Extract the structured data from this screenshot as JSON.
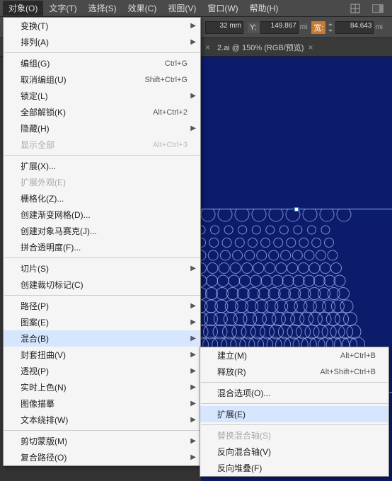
{
  "menubar": {
    "items": [
      {
        "label": "对象(O)",
        "active": true
      },
      {
        "label": "文字(T)"
      },
      {
        "label": "选择(S)"
      },
      {
        "label": "效果(C)"
      },
      {
        "label": "视图(V)"
      },
      {
        "label": "窗口(W)"
      },
      {
        "label": "帮助(H)"
      }
    ]
  },
  "toolbar": {
    "y_value": "32 mm",
    "y_label": "Y:",
    "h_value": "149.867",
    "w_label": "宽:",
    "w_value": "84.643",
    "unit": "mi"
  },
  "tabs": {
    "tab1": {
      "label": "2.ai @ 150% (RGB/预览)"
    }
  },
  "dropdown": [
    {
      "type": "item",
      "label": "变换(T)",
      "sub": true
    },
    {
      "type": "item",
      "label": "排列(A)",
      "sub": true
    },
    {
      "type": "sep"
    },
    {
      "type": "item",
      "label": "编组(G)",
      "shortcut": "Ctrl+G"
    },
    {
      "type": "item",
      "label": "取消编组(U)",
      "shortcut": "Shift+Ctrl+G"
    },
    {
      "type": "item",
      "label": "锁定(L)",
      "sub": true
    },
    {
      "type": "item",
      "label": "全部解锁(K)",
      "shortcut": "Alt+Ctrl+2"
    },
    {
      "type": "item",
      "label": "隐藏(H)",
      "sub": true
    },
    {
      "type": "item",
      "label": "显示全部",
      "shortcut": "Alt+Ctrl+3",
      "disabled": true
    },
    {
      "type": "sep"
    },
    {
      "type": "item",
      "label": "扩展(X)..."
    },
    {
      "type": "item",
      "label": "扩展外观(E)",
      "disabled": true
    },
    {
      "type": "item",
      "label": "栅格化(Z)..."
    },
    {
      "type": "item",
      "label": "创建渐变网格(D)..."
    },
    {
      "type": "item",
      "label": "创建对象马赛克(J)..."
    },
    {
      "type": "item",
      "label": "拼合透明度(F)..."
    },
    {
      "type": "sep"
    },
    {
      "type": "item",
      "label": "切片(S)",
      "sub": true
    },
    {
      "type": "item",
      "label": "创建裁切标记(C)"
    },
    {
      "type": "sep"
    },
    {
      "type": "item",
      "label": "路径(P)",
      "sub": true
    },
    {
      "type": "item",
      "label": "图案(E)",
      "sub": true
    },
    {
      "type": "item",
      "label": "混合(B)",
      "sub": true,
      "highlight": true
    },
    {
      "type": "item",
      "label": "封套扭曲(V)",
      "sub": true
    },
    {
      "type": "item",
      "label": "透视(P)",
      "sub": true
    },
    {
      "type": "item",
      "label": "实时上色(N)",
      "sub": true
    },
    {
      "type": "item",
      "label": "图像描摹",
      "sub": true
    },
    {
      "type": "item",
      "label": "文本绕排(W)",
      "sub": true
    },
    {
      "type": "sep"
    },
    {
      "type": "item",
      "label": "剪切蒙版(M)",
      "sub": true
    },
    {
      "type": "item",
      "label": "复合路径(O)",
      "sub": true
    }
  ],
  "submenu": [
    {
      "type": "item",
      "label": "建立(M)",
      "shortcut": "Alt+Ctrl+B"
    },
    {
      "type": "item",
      "label": "释放(R)",
      "shortcut": "Alt+Shift+Ctrl+B"
    },
    {
      "type": "sep"
    },
    {
      "type": "item",
      "label": "混合选项(O)..."
    },
    {
      "type": "sep"
    },
    {
      "type": "item",
      "label": "扩展(E)",
      "highlight": true
    },
    {
      "type": "sep"
    },
    {
      "type": "item",
      "label": "替换混合轴(S)",
      "disabled": true
    },
    {
      "type": "item",
      "label": "反向混合轴(V)"
    },
    {
      "type": "item",
      "label": "反向堆叠(F)"
    }
  ]
}
